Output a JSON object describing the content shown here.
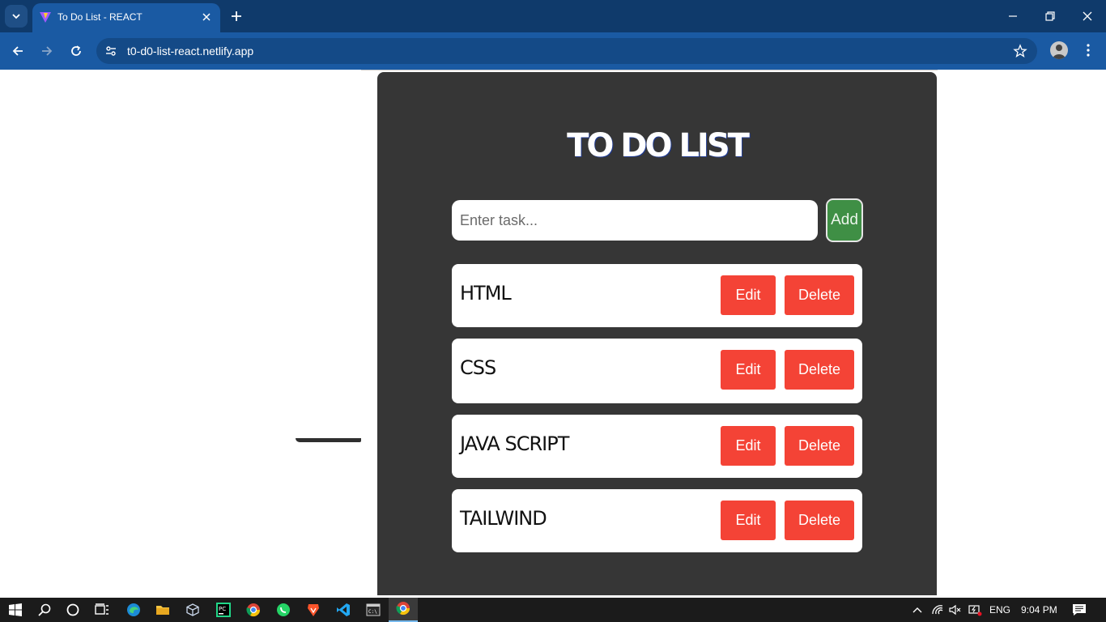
{
  "browser": {
    "tab_title": "To Do List - REACT",
    "url": "t0-d0-list-react.netlify.app"
  },
  "app": {
    "title": "TO DO LIST",
    "input_placeholder": "Enter task...",
    "add_label": "Add",
    "items": [
      {
        "text": "HTML",
        "edit_label": "Edit",
        "delete_label": "Delete"
      },
      {
        "text": "CSS",
        "edit_label": "Edit",
        "delete_label": "Delete"
      },
      {
        "text": "JAVA SCRIPT",
        "edit_label": "Edit",
        "delete_label": "Delete"
      },
      {
        "text": "TAILWIND",
        "edit_label": "Edit",
        "delete_label": "Delete"
      }
    ]
  },
  "taskbar": {
    "language": "ENG",
    "time": "9:04 PM"
  },
  "colors": {
    "card_bg": "#363636",
    "add_button": "#3f8f45",
    "action_button": "#f44336",
    "browser_frame": "#1a5aa3"
  }
}
